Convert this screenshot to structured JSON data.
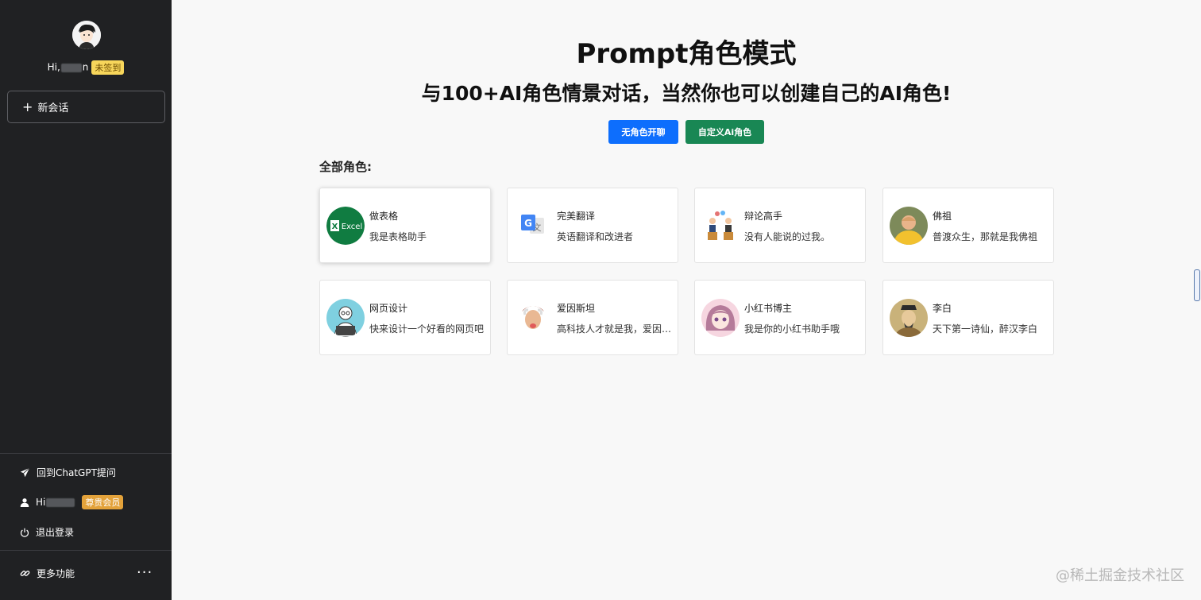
{
  "sidebar": {
    "greeting_prefix": "Hi,",
    "greeting_suffix": "n",
    "checkin_badge": "未签到",
    "new_chat_label": "新会话",
    "items": [
      {
        "label": "回到ChatGPT提问",
        "icon": "send-icon"
      },
      {
        "label": "Hi",
        "icon": "user-icon",
        "badge": "尊贵会员"
      },
      {
        "label": "退出登录",
        "icon": "power-icon"
      }
    ],
    "more_label": "更多功能",
    "more_dots": "···"
  },
  "main": {
    "title": "Prompt角色模式",
    "subtitle": "与100+AI角色情景对话，当然你也可以创建自己的AI角色!",
    "btn_no_role": "无角色开聊",
    "btn_custom_role": "自定义Ai角色",
    "section_label": "全部角色:",
    "roles": [
      {
        "name": "做表格",
        "desc": "我是表格助手",
        "icon": "excel-icon",
        "img_text": "Excel"
      },
      {
        "name": "完美翻译",
        "desc": "英语翻译和改进者",
        "icon": "google-translate-icon"
      },
      {
        "name": "辩论高手",
        "desc": "没有人能说的过我。",
        "icon": "debate-icon"
      },
      {
        "name": "佛祖",
        "desc": "普渡众生，那就是我佛祖",
        "icon": "buddha-avatar"
      },
      {
        "name": "网页设计",
        "desc": "快来设计一个好看的网页吧",
        "icon": "web-designer-avatar"
      },
      {
        "name": "爱因斯坦",
        "desc": "高科技人才就是我，爱因斯坦",
        "icon": "einstein-avatar"
      },
      {
        "name": "小红书博主",
        "desc": "我是你的小红书助手哦",
        "icon": "anime-girl-avatar"
      },
      {
        "name": "李白",
        "desc": "天下第一诗仙，醉汉李白",
        "icon": "libai-avatar"
      }
    ]
  },
  "watermark": "@稀土掘金技术社区",
  "colors": {
    "sidebar_bg": "#202123",
    "primary": "#0d6efd",
    "success": "#198754",
    "badge_yellow": "#f7d65b",
    "badge_orange": "#e3a23a"
  }
}
